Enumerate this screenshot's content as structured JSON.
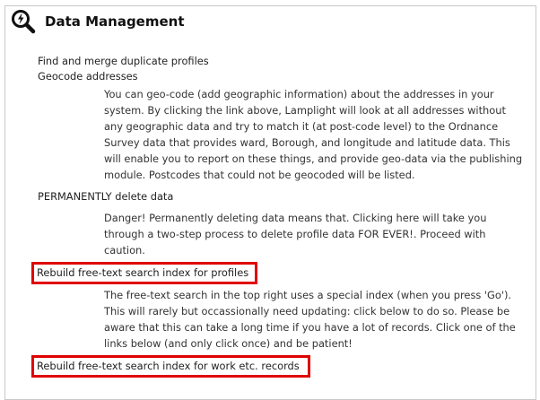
{
  "header": {
    "title": "Data Management",
    "icon": "magnifier-bolt-icon"
  },
  "items": [
    {
      "label": "Find and merge duplicate profiles"
    },
    {
      "label": "Geocode addresses",
      "description": "You can geo-code (add geographic information) about the addresses in your system. By clicking the link above, Lamplight will look at all addresses without any geographic data and try to match it (at post-code level) to the Ordnance Survey data that provides ward, Borough, and longitude and latitude data. This will enable you to report on these things, and provide geo-data via the publishing module. Postcodes that could not be geocoded will be listed."
    },
    {
      "label": "PERMANENTLY delete data",
      "description": "Danger! Permanently deleting data means that. Clicking here will take you through a two-step process to delete profile data FOR EVER!. Proceed with caution."
    },
    {
      "label": "Rebuild free-text search index for profiles",
      "description": "The free-text search in the top right uses a special index (when you press 'Go'). This will rarely but occassionally need updating: click below to do so. Please be aware that this can take a long time if you have a lot of records. Click one of the links below (and only click once) and be patient!"
    },
    {
      "label": "Rebuild free-text search index for work etc. records"
    }
  ],
  "colors": {
    "highlight": "#e00000",
    "border": "#c8c8c8"
  }
}
